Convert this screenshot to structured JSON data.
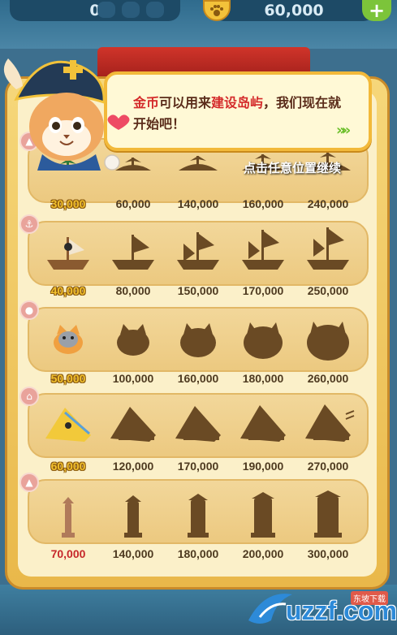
{
  "topbar": {
    "left_value": "0",
    "right_value": "60,000",
    "plus_label": "+",
    "paw_icon": "paw-icon"
  },
  "dialog": {
    "part1": "金币",
    "part2": "可以用来",
    "part3": "建设岛屿",
    "part4": "，我们现在就开始吧！",
    "next_glyph": "»»"
  },
  "continue_hint": "点击任意位置继续",
  "rows": [
    {
      "category": "island",
      "icon": "flag-icon",
      "prices": [
        "30,000",
        "60,000",
        "140,000",
        "160,000",
        "240,000"
      ]
    },
    {
      "category": "ship",
      "icon": "anchor-icon",
      "prices": [
        "40,000",
        "80,000",
        "150,000",
        "170,000",
        "250,000"
      ]
    },
    {
      "category": "cat",
      "icon": "paw-icon",
      "prices": [
        "50,000",
        "100,000",
        "160,000",
        "180,000",
        "260,000"
      ]
    },
    {
      "category": "tent",
      "icon": "house-icon",
      "prices": [
        "60,000",
        "120,000",
        "170,000",
        "190,000",
        "270,000"
      ]
    },
    {
      "category": "tower",
      "icon": "tower-icon",
      "prices": [
        "70,000",
        "140,000",
        "180,000",
        "200,000",
        "300,000"
      ]
    }
  ],
  "watermark": {
    "text": "uzzf.com",
    "sub": "东坡下载"
  },
  "colors": {
    "gold": "#f2c02d",
    "red": "#c6272a",
    "silhouette": "#6a4a24",
    "green": "#6cbf2a"
  }
}
